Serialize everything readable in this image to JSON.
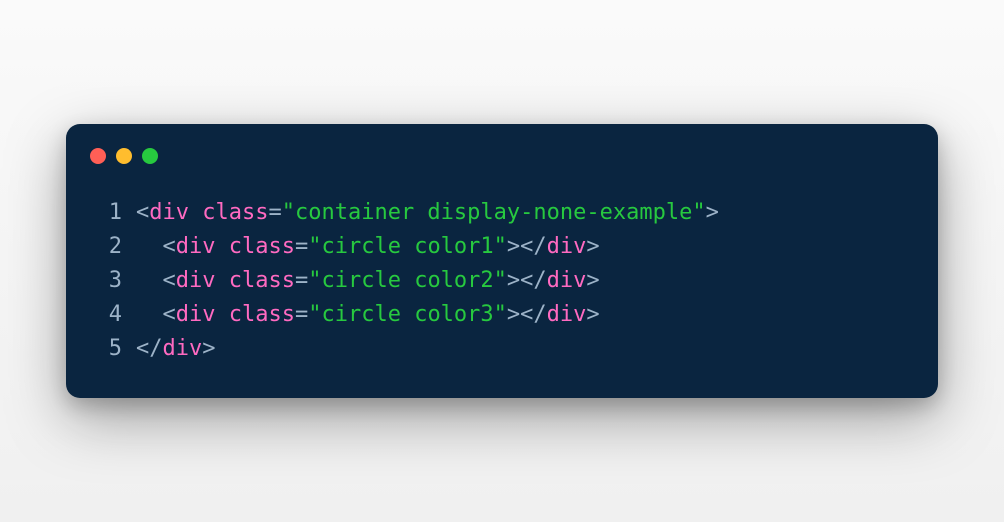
{
  "window": {
    "controls": [
      "close",
      "minimize",
      "maximize"
    ]
  },
  "code": {
    "lines": [
      {
        "num": "1",
        "indent": "",
        "tokens": [
          {
            "t": "punct",
            "v": "<"
          },
          {
            "t": "tag",
            "v": "div"
          },
          {
            "t": "punct",
            "v": " "
          },
          {
            "t": "attr",
            "v": "class"
          },
          {
            "t": "eq",
            "v": "="
          },
          {
            "t": "str",
            "v": "\"container display-none-example\""
          },
          {
            "t": "punct",
            "v": ">"
          }
        ]
      },
      {
        "num": "2",
        "indent": "  ",
        "tokens": [
          {
            "t": "punct",
            "v": "<"
          },
          {
            "t": "tag",
            "v": "div"
          },
          {
            "t": "punct",
            "v": " "
          },
          {
            "t": "attr",
            "v": "class"
          },
          {
            "t": "eq",
            "v": "="
          },
          {
            "t": "str",
            "v": "\"circle color1\""
          },
          {
            "t": "punct",
            "v": "></"
          },
          {
            "t": "tag",
            "v": "div"
          },
          {
            "t": "punct",
            "v": ">"
          }
        ]
      },
      {
        "num": "3",
        "indent": "  ",
        "tokens": [
          {
            "t": "punct",
            "v": "<"
          },
          {
            "t": "tag",
            "v": "div"
          },
          {
            "t": "punct",
            "v": " "
          },
          {
            "t": "attr",
            "v": "class"
          },
          {
            "t": "eq",
            "v": "="
          },
          {
            "t": "str",
            "v": "\"circle color2\""
          },
          {
            "t": "punct",
            "v": "></"
          },
          {
            "t": "tag",
            "v": "div"
          },
          {
            "t": "punct",
            "v": ">"
          }
        ]
      },
      {
        "num": "4",
        "indent": "  ",
        "tokens": [
          {
            "t": "punct",
            "v": "<"
          },
          {
            "t": "tag",
            "v": "div"
          },
          {
            "t": "punct",
            "v": " "
          },
          {
            "t": "attr",
            "v": "class"
          },
          {
            "t": "eq",
            "v": "="
          },
          {
            "t": "str",
            "v": "\"circle color3\""
          },
          {
            "t": "punct",
            "v": "></"
          },
          {
            "t": "tag",
            "v": "div"
          },
          {
            "t": "punct",
            "v": ">"
          }
        ]
      },
      {
        "num": "5",
        "indent": "",
        "tokens": [
          {
            "t": "punct",
            "v": "</"
          },
          {
            "t": "tag",
            "v": "div"
          },
          {
            "t": "punct",
            "v": ">"
          }
        ]
      }
    ]
  }
}
